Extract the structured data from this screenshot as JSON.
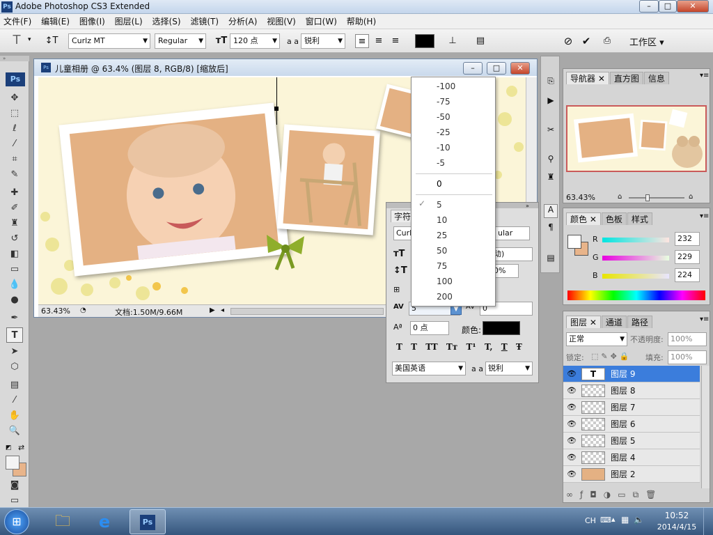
{
  "app": {
    "title": "Adobe Photoshop CS3 Extended",
    "logo": "Ps"
  },
  "window_buttons": {
    "minimize": "–",
    "maximize": "□",
    "close": "✕"
  },
  "menu": [
    "文件(F)",
    "编辑(E)",
    "图像(I)",
    "图层(L)",
    "选择(S)",
    "滤镜(T)",
    "分析(A)",
    "视图(V)",
    "窗口(W)",
    "帮助(H)"
  ],
  "options": {
    "font_family": "Curlz MT",
    "font_style": "Regular",
    "font_size": "120 点",
    "antialias_label": "a a",
    "antialias": "锐利",
    "workspace": "工作区",
    "text_color": "#000000"
  },
  "document": {
    "title": "儿童相册 @ 63.4% (图层 8, RGB/8) [缩放后]",
    "zoom": "63.43%",
    "doc_info": "文档:1.50M/9.66M"
  },
  "char_panel": {
    "tab": "字符",
    "font_family_partial": "Curlz",
    "font_style_partial": "ular",
    "leading_partial": "动)",
    "scale_partial": "0%",
    "kerning_partial": "5",
    "tracking_partial": "0",
    "baseline": "0 点",
    "color_label": "颜色:",
    "language": "美国英语",
    "antialias_label": "a a",
    "antialias": "锐利",
    "style_buttons": [
      "T",
      "T",
      "TT",
      "Tт",
      "T¹",
      "T,",
      "T",
      "Ŧ"
    ]
  },
  "dropdown": {
    "items": [
      "-100",
      "-75",
      "-50",
      "-25",
      "-10",
      "-5",
      "0",
      "5",
      "10",
      "25",
      "50",
      "75",
      "100",
      "200"
    ],
    "checked": "5"
  },
  "navigator": {
    "tabs": [
      "导航器",
      "直方图",
      "信息"
    ],
    "zoom": "63.43%"
  },
  "color_panel": {
    "tabs": [
      "颜色",
      "色板",
      "样式"
    ],
    "channels": [
      {
        "label": "R",
        "value": "232"
      },
      {
        "label": "G",
        "value": "229"
      },
      {
        "label": "B",
        "value": "224"
      }
    ],
    "foreground": "#ffffff",
    "background": "#e8b48a"
  },
  "layers_panel": {
    "tabs": [
      "图层",
      "通道",
      "路径"
    ],
    "blend_mode": "正常",
    "opacity_label": "不透明度:",
    "opacity": "100%",
    "lock_label": "锁定:",
    "fill_label": "填充:",
    "fill": "100%",
    "layers": [
      "图层 9",
      "图层 8",
      "图层 7",
      "图层 6",
      "图层 5",
      "图层 4",
      "图层 2"
    ],
    "selected": "图层 9",
    "text_layer_glyph": "T"
  },
  "taskbar": {
    "language": "CH",
    "time": "10:52",
    "date": "2014/4/15",
    "ps_label": "Ps"
  }
}
